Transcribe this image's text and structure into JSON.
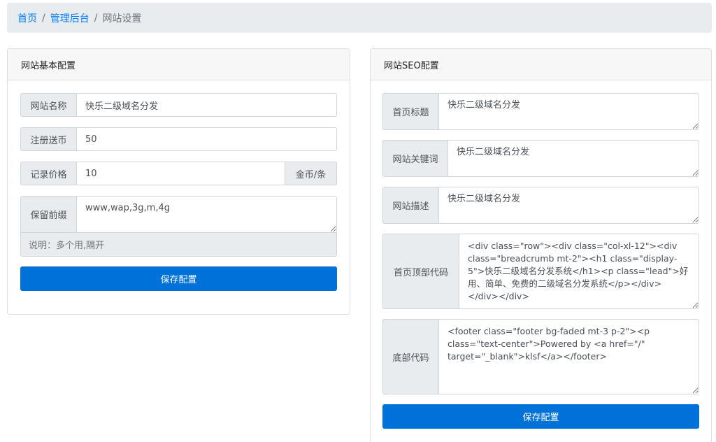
{
  "breadcrumb": {
    "home": "首页",
    "admin": "管理后台",
    "current": "网站设置",
    "separator": "/"
  },
  "basic": {
    "title": "网站基本配置",
    "site_name_label": "网站名称",
    "site_name_value": "快乐二级域名分发",
    "register_coin_label": "注册送币",
    "register_coin_value": "50",
    "record_price_label": "记录价格",
    "record_price_value": "10",
    "record_price_unit": "金币/条",
    "reserved_prefix_label": "保留前缀",
    "reserved_prefix_value": "www,wap,3g,m,4g",
    "reserved_prefix_hint": "说明：多个用,隔开",
    "save_label": "保存配置"
  },
  "seo": {
    "title": "网站SEO配置",
    "home_title_label": "首页标题",
    "home_title_value": "快乐二级域名分发",
    "keywords_label": "网站关键词",
    "keywords_value": "快乐二级域名分发",
    "description_label": "网站描述",
    "description_value": "快乐二级域名分发",
    "header_code_label": "首页顶部代码",
    "header_code_value": "<div class=\"row\"><div class=\"col-xl-12\"><div class=\"breadcrumb mt-2\"><h1 class=\"display-5\">快乐二级域名分发系统</h1><p class=\"lead\">好用、简单、免费的二级域名分发系统</p></div></div></div>",
    "footer_code_label": "底部代码",
    "footer_code_value": "<footer class=\"footer bg-faded mt-3 p-2\"><p class=\"text-center\">Powered by <a href=\"/\" target=\"_blank\">klsf</a></footer>",
    "save_label": "保存配置"
  }
}
